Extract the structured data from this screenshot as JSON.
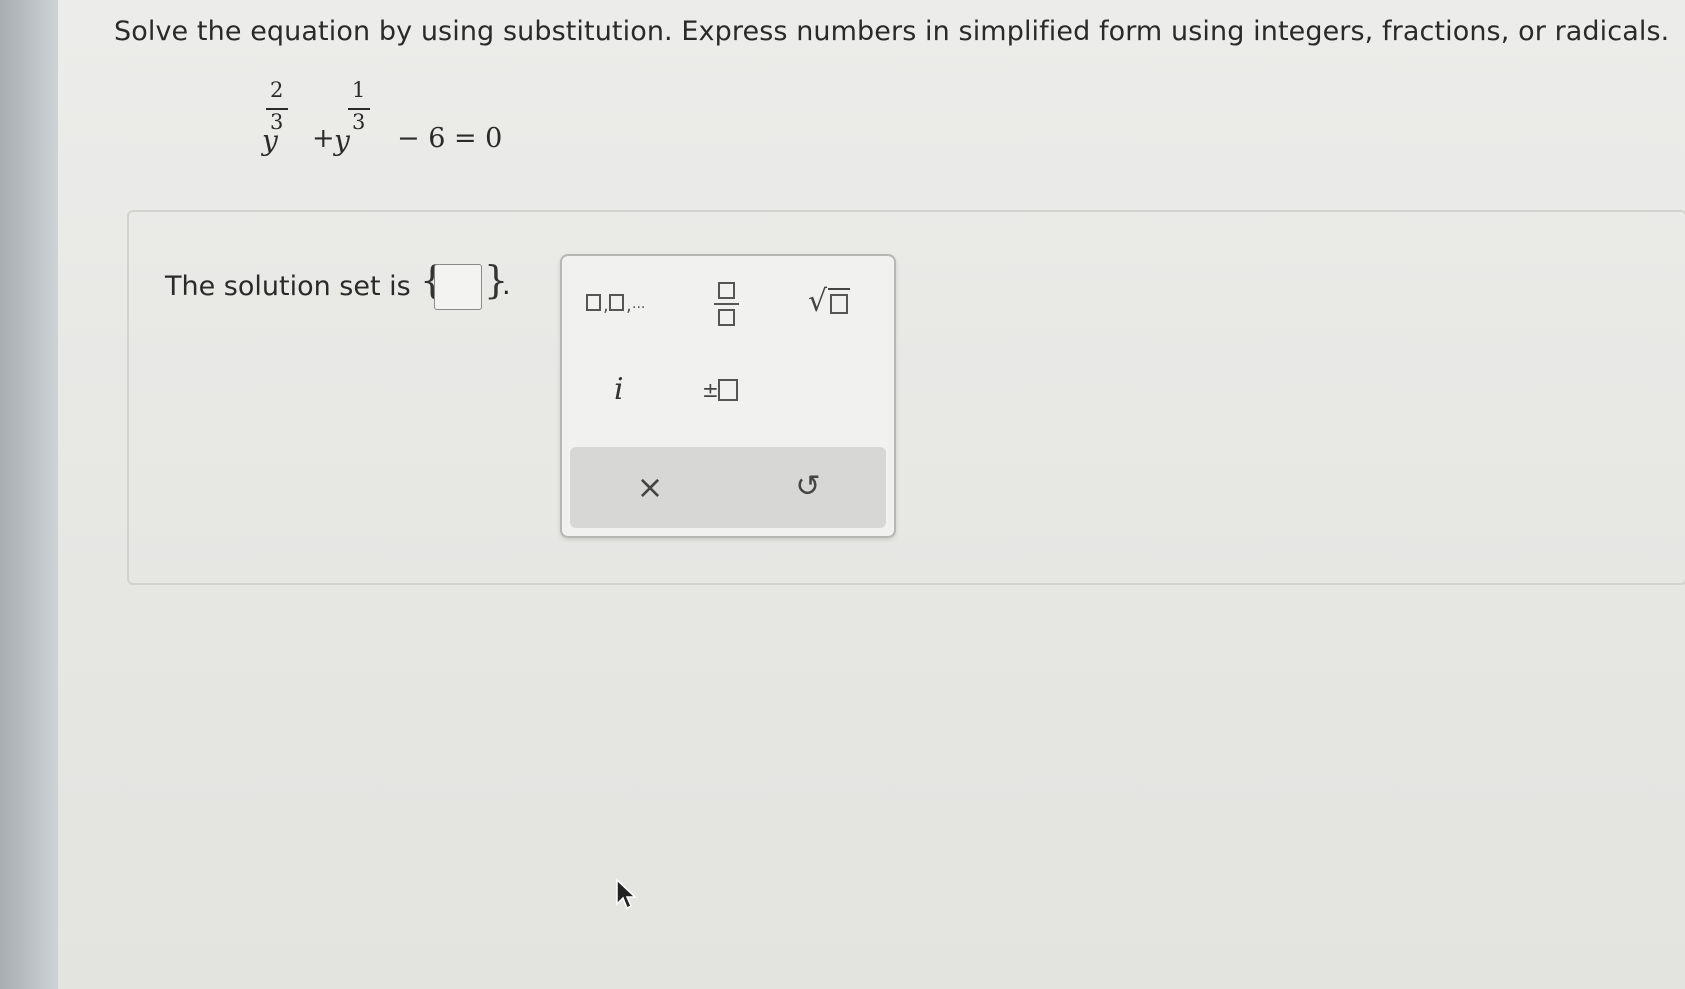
{
  "question": {
    "instruction": "Solve the equation by using substitution. Express numbers in simplified form using integers, fractions, or radicals.",
    "equation": {
      "var1": "y",
      "exp1_num": "2",
      "exp1_den": "3",
      "plus": "+",
      "var2": "y",
      "exp2_num": "1",
      "exp2_den": "3",
      "rest": "− 6 = 0"
    }
  },
  "answer": {
    "label": "The solution set is",
    "open_brace": "{",
    "close_brace": "}",
    "period": ".",
    "input_value": ""
  },
  "palette": {
    "list_separator": ",",
    "list_ellipsis": "...",
    "imaginary_unit": "i",
    "plus_minus": "±",
    "sqrt_symbol": "√",
    "clear": "×",
    "undo": "↺"
  },
  "icons": {
    "list": "comma-list-icon",
    "fraction": "fraction-icon",
    "sqrt": "square-root-icon",
    "imaginary": "imaginary-unit-icon",
    "plusminus": "plus-minus-icon",
    "clear": "close-icon",
    "undo": "undo-icon",
    "cursor": "mouse-pointer-icon"
  }
}
